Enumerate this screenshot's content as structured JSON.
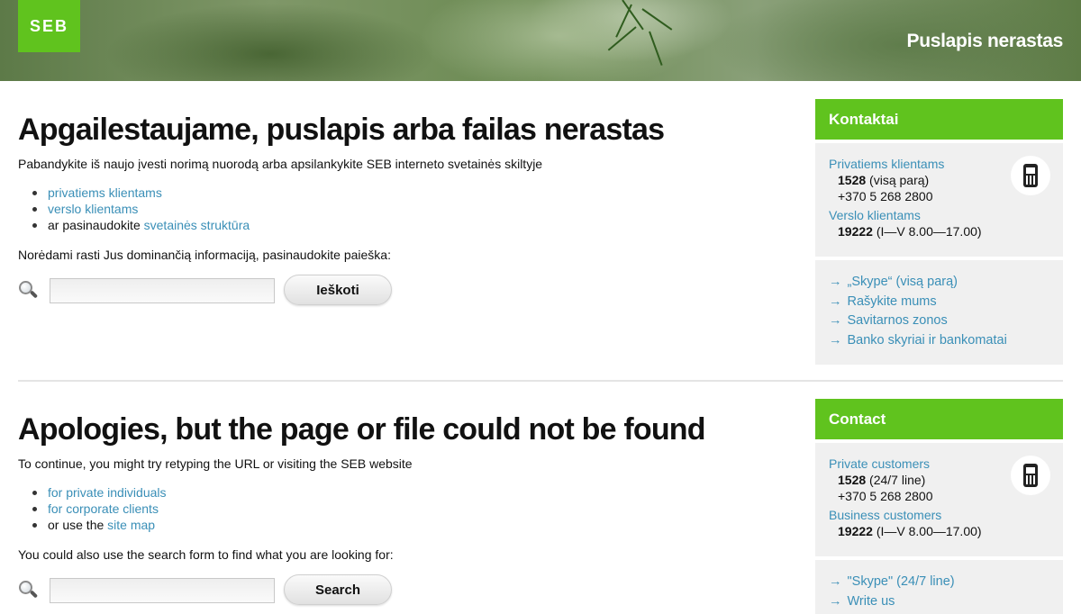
{
  "banner": {
    "logo": "SEB",
    "title": "Puslapis nerastas"
  },
  "lt": {
    "heading": "Apgailestaujame, puslapis arba failas nerastas",
    "intro": "Pabandykite iš naujo įvesti norimą nuorodą arba apsilankykite SEB interneto svetainės skiltyje",
    "links": [
      {
        "text": "privatiems klientams"
      },
      {
        "text": "verslo klientams"
      }
    ],
    "last_prefix": "ar pasinaudokite ",
    "last_link": "svetainės struktūra",
    "search_hint": "Norėdami rasti Jus dominančią informaciją, pasinaudokite paieška:",
    "search_placeholder": "",
    "search_button": "Ieškoti"
  },
  "lt_side": {
    "title": "Kontaktai",
    "private_label": "Privatiems klientams",
    "private_number": "1528",
    "private_hours": " (visą parą)",
    "private_phone": "+370 5 268 2800",
    "business_label": "Verslo klientams",
    "business_number": "19222",
    "business_hours": " (I—V 8.00—17.00)",
    "links": [
      "„Skype“ (visą parą)",
      "Rašykite mums",
      "Savitarnos zonos",
      "Banko skyriai ir bankomatai"
    ]
  },
  "en": {
    "heading": "Apologies, but the page or file could not be found",
    "intro": "To continue, you might try retyping the URL or visiting the SEB website",
    "links": [
      {
        "text": "for private individuals"
      },
      {
        "text": "for corporate clients"
      }
    ],
    "last_prefix": "or use the ",
    "last_link": "site map",
    "search_hint": "You could also use the search form to find what you are looking for:",
    "search_placeholder": "",
    "search_button": "Search"
  },
  "en_side": {
    "title": "Contact",
    "private_label": "Private customers",
    "private_number": "1528",
    "private_hours": " (24/7 line)",
    "private_phone": "+370 5 268 2800",
    "business_label": "Business customers",
    "business_number": "19222",
    "business_hours": " (I—V 8.00—17.00)",
    "links": [
      "\"Skype\" (24/7 line)",
      "Write us"
    ]
  },
  "colors": {
    "brand_green": "#60c31e",
    "link_blue": "#3a8fb7",
    "panel_gray": "#f0f0f0"
  },
  "icons": [
    "search-icon",
    "mobile-phone-icon",
    "arrow-right-icon"
  ]
}
